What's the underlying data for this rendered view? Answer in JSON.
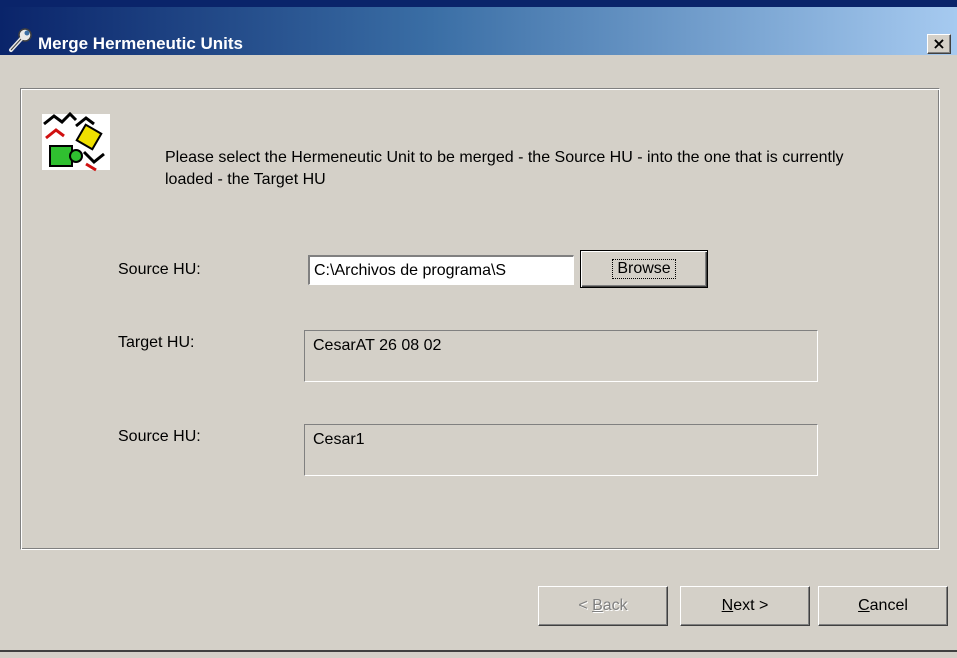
{
  "window": {
    "title": "Merge Hermeneutic Units",
    "close_glyph": "×",
    "title_icon": "tools-icon"
  },
  "main": {
    "logo": "puzzle-logo",
    "instruction": "Please select the Hermeneutic Unit to be merged - the Source HU - into the one that is currently loaded - the Target HU",
    "source_label": "Source HU:",
    "source_path": "C:\\Archivos de programa\\S",
    "browse_label": "Browse",
    "target_label": "Target HU:",
    "target_value": "CesarAT 26 08 02",
    "source_label_2": "Source HU:",
    "source_value": "Cesar1"
  },
  "footer": {
    "back_prefix": "< ",
    "back_key": "B",
    "back_rest": "ack",
    "next_key": "N",
    "next_rest": "ext >",
    "cancel_key": "C",
    "cancel_rest": "ancel"
  }
}
